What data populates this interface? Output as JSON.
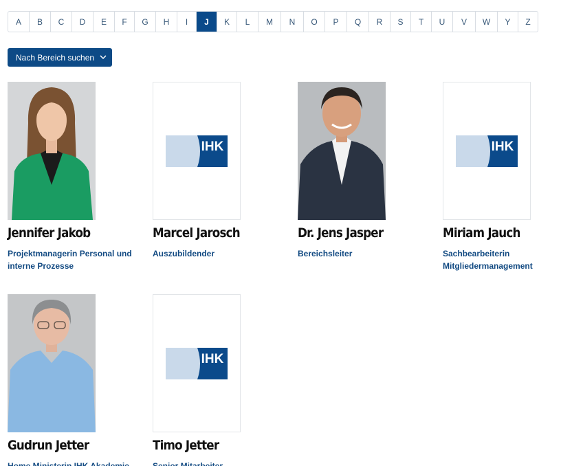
{
  "alphabet": {
    "letters": [
      "A",
      "B",
      "C",
      "D",
      "E",
      "F",
      "G",
      "H",
      "I",
      "J",
      "K",
      "L",
      "M",
      "N",
      "O",
      "P",
      "Q",
      "R",
      "S",
      "T",
      "U",
      "V",
      "W",
      "Y",
      "Z"
    ],
    "active": "J"
  },
  "filter": {
    "label": "Nach Bereich suchen",
    "icon": "chevron-down-icon"
  },
  "people": [
    {
      "name": "Jennifer Jakob",
      "role": "Projektmanagerin Personal und interne Prozesse",
      "photo": "portrait"
    },
    {
      "name": "Marcel Jarosch",
      "role": "Auszubildender",
      "photo": "ihk-logo"
    },
    {
      "name": "Dr. Jens Jasper",
      "role": "Bereichsleiter",
      "photo": "portrait"
    },
    {
      "name": "Miriam Jauch",
      "role": "Sachbearbeiterin Mitgliedermanagement",
      "photo": "ihk-logo"
    },
    {
      "name": "Gudrun Jetter",
      "role": "Home Ministerin IHK Akademie",
      "photo": "portrait"
    },
    {
      "name": "Timo Jetter",
      "role": "Senior Mitarbeiter",
      "photo": "ihk-logo"
    }
  ],
  "logo_text": "IHK",
  "colors": {
    "brand": "#0a4a8a",
    "logo_light": "#c9d9ea",
    "logo_dark": "#0b4a8b"
  }
}
